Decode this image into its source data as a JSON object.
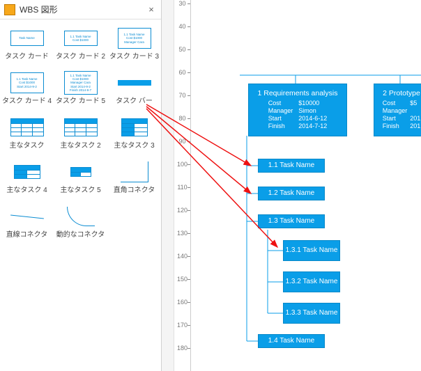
{
  "panel": {
    "title": "WBS 図形",
    "close": "×",
    "shapes": [
      {
        "label": "タスク カード"
      },
      {
        "label": "タスク カード 2"
      },
      {
        "label": "タスク カード 3"
      },
      {
        "label": "タスク カード 4"
      },
      {
        "label": "タスク カード 5"
      },
      {
        "label": "タスク バー"
      },
      {
        "label": "主なタスク"
      },
      {
        "label": "主なタスク 2"
      },
      {
        "label": "主なタスク 3"
      },
      {
        "label": "主なタスク 4"
      },
      {
        "label": "主なタスク 5"
      },
      {
        "label": "直角コネクタ"
      },
      {
        "label": "直線コネクタ"
      },
      {
        "label": "動的なコネクタ"
      }
    ],
    "thumb_text": {
      "task_name": "Task Name",
      "card2_line1": "1.1 Task Name",
      "card2_line2": "Cost    $1000",
      "card3_line1": "1.1 Task Name",
      "card3_line2": "Cost    $1000",
      "card3_line3": "Manager  Cara",
      "card4_line1": "1.1 Task Name",
      "card4_line2": "Cost    $1000",
      "card4_line3": "Start  2014-9-2",
      "card5_line1": "1.1 Task Name",
      "card5_line2": "Cost    $1000",
      "card5_line3": "Manager  Cara",
      "card5_line4": "Start  2014-9-2",
      "card5_line5": "Finish 2014-9-7"
    }
  },
  "ruler": {
    "ticks": [
      "30",
      "40",
      "50",
      "60",
      "70",
      "80",
      "90",
      "100",
      "110",
      "120",
      "130",
      "140",
      "150",
      "160",
      "170",
      "180"
    ]
  },
  "diagram": {
    "req": {
      "title": "1 Requirements analysis",
      "rows": [
        [
          "Cost",
          "$10000"
        ],
        [
          "Manager",
          "Simon"
        ],
        [
          "Start",
          "2014-6-12"
        ],
        [
          "Finish",
          "2014-7-12"
        ]
      ]
    },
    "proto": {
      "title": "2 Prototype",
      "rows": [
        [
          "Cost",
          "$5"
        ],
        [
          "Manager",
          ""
        ],
        [
          "Start",
          "201"
        ],
        [
          "Finish",
          "201"
        ]
      ]
    },
    "children": [
      "1.1 Task Name",
      "1.2 Task Name",
      "1.3 Task Name",
      "1.4 Task Name"
    ],
    "grandchildren": [
      "1.3.1 Task Name",
      "1.3.2 Task Name",
      "1.3.3 Task Name"
    ]
  }
}
